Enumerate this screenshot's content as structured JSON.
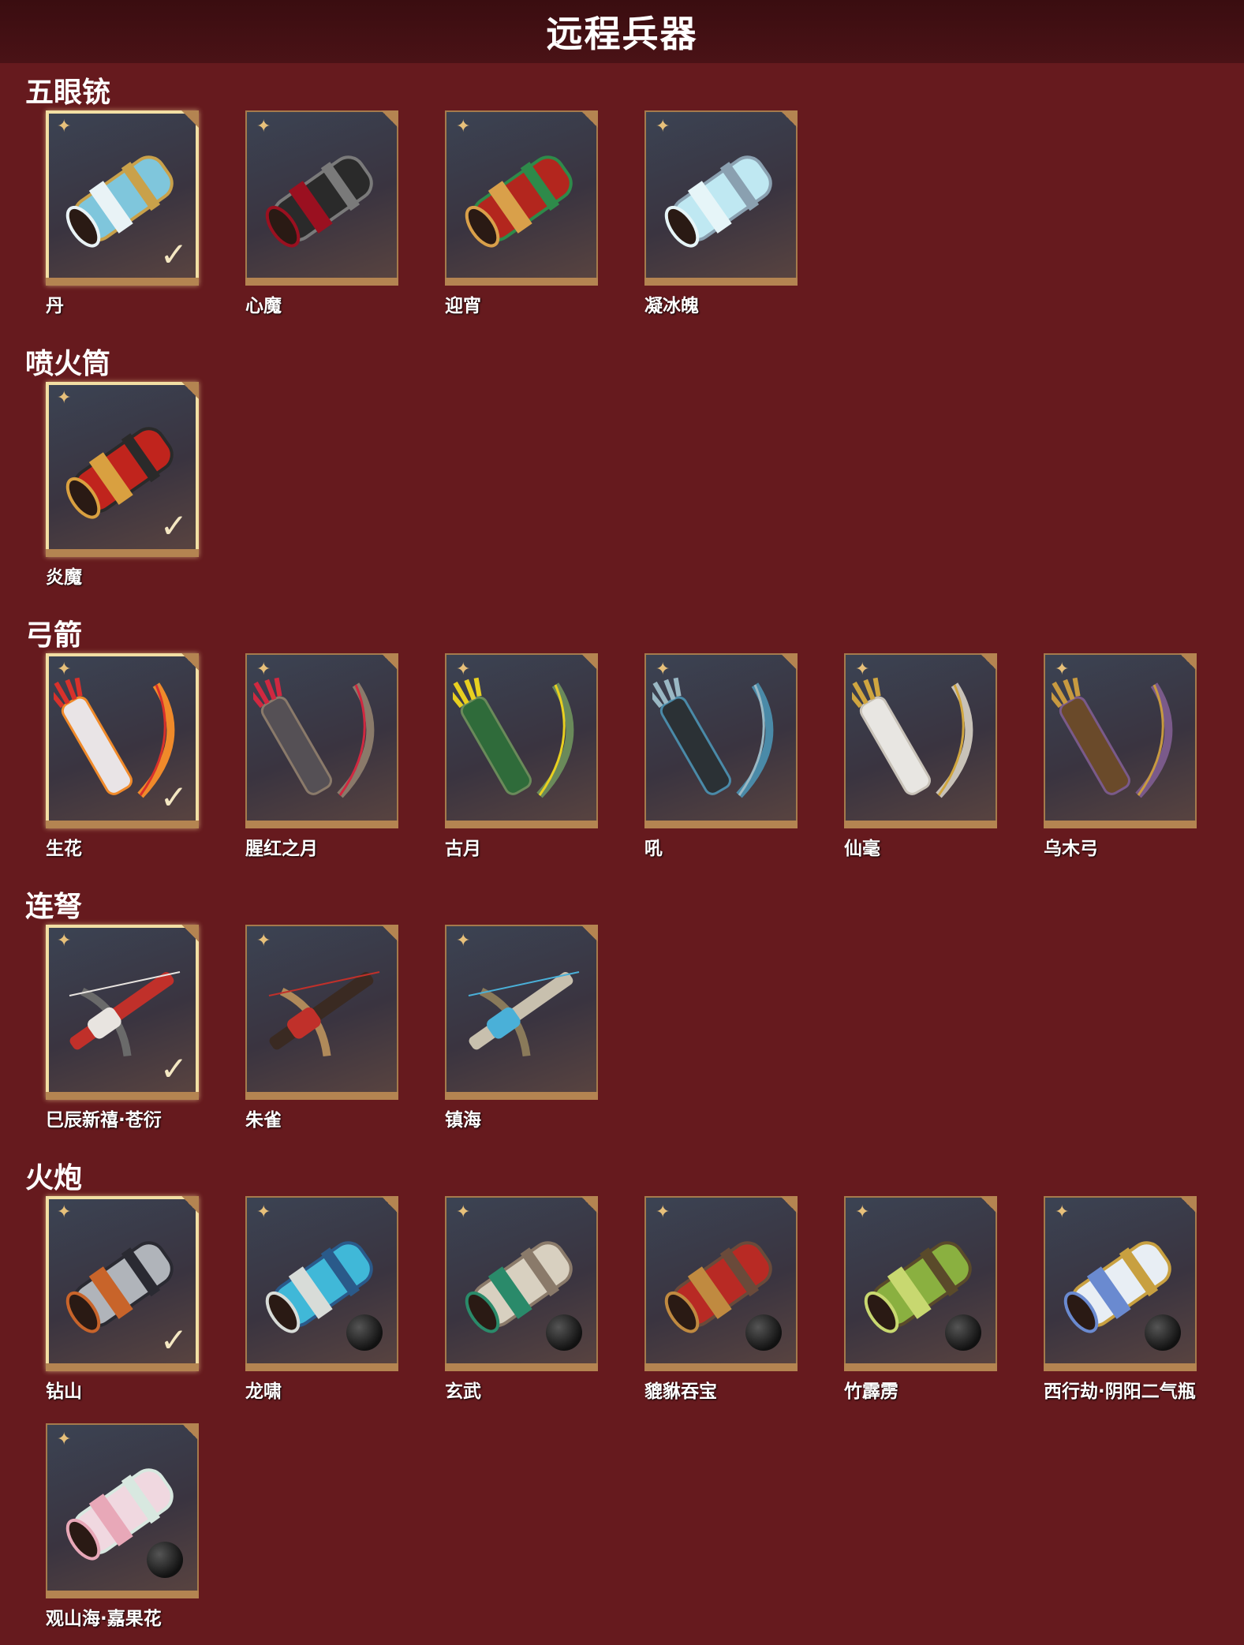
{
  "page_title": "远程兵器",
  "categories": [
    {
      "name": "五眼铳",
      "items": [
        {
          "label": "丹",
          "selected": true,
          "ammo": false,
          "colors": [
            "#7fc6dc",
            "#e9f3f6",
            "#c9a14a"
          ]
        },
        {
          "label": "心魔",
          "selected": false,
          "ammo": false,
          "colors": [
            "#2a2a2a",
            "#9a1020",
            "#7a7a7a"
          ]
        },
        {
          "label": "迎宵",
          "selected": false,
          "ammo": false,
          "colors": [
            "#b3261e",
            "#d9a04a",
            "#2e8a4a"
          ]
        },
        {
          "label": "凝冰魄",
          "selected": false,
          "ammo": false,
          "colors": [
            "#bfe8f2",
            "#e6f5f8",
            "#8aa0b0"
          ]
        }
      ]
    },
    {
      "name": "喷火筒",
      "items": [
        {
          "label": "炎魔",
          "selected": true,
          "ammo": false,
          "colors": [
            "#c0241d",
            "#d9a040",
            "#2a2a2a"
          ]
        }
      ]
    },
    {
      "name": "弓箭",
      "items": [
        {
          "label": "生花",
          "selected": true,
          "ammo": false,
          "colors": [
            "#e9e4e6",
            "#d8312b",
            "#f08a2a"
          ]
        },
        {
          "label": "腥红之月",
          "selected": false,
          "ammo": false,
          "colors": [
            "#555055",
            "#d02840",
            "#8a7a6a"
          ]
        },
        {
          "label": "古月",
          "selected": false,
          "ammo": false,
          "colors": [
            "#2f6b3a",
            "#e8d020",
            "#6a8a5a"
          ]
        },
        {
          "label": "吼",
          "selected": false,
          "ammo": false,
          "colors": [
            "#2b3135",
            "#9ab8c4",
            "#4a8aa8"
          ]
        },
        {
          "label": "仙毫",
          "selected": false,
          "ammo": false,
          "colors": [
            "#e8e6e2",
            "#d0a640",
            "#c8c2b8"
          ]
        },
        {
          "label": "乌木弓",
          "selected": false,
          "ammo": false,
          "colors": [
            "#6a4a2a",
            "#c89a40",
            "#7a5a8a"
          ]
        }
      ]
    },
    {
      "name": "连弩",
      "items": [
        {
          "label": "巳辰新禧·苍衍",
          "selected": true,
          "ammo": false,
          "colors": [
            "#c0302a",
            "#e8e4e0",
            "#6a6a6a"
          ]
        },
        {
          "label": "朱雀",
          "selected": false,
          "ammo": false,
          "colors": [
            "#3a2a22",
            "#c0302a",
            "#b08a5a"
          ]
        },
        {
          "label": "镇海",
          "selected": false,
          "ammo": false,
          "colors": [
            "#c8c0ae",
            "#4ab0d8",
            "#8a7a5a"
          ]
        }
      ]
    },
    {
      "name": "火炮",
      "items": [
        {
          "label": "钻山",
          "selected": true,
          "ammo": false,
          "colors": [
            "#b0b4ba",
            "#c8642a",
            "#2a2a32"
          ]
        },
        {
          "label": "龙啸",
          "selected": false,
          "ammo": true,
          "colors": [
            "#40b8d8",
            "#d8dcd8",
            "#2a5a8a"
          ]
        },
        {
          "label": "玄武",
          "selected": false,
          "ammo": true,
          "colors": [
            "#d8d0c0",
            "#2a8a6a",
            "#8a7a6a"
          ]
        },
        {
          "label": "貔貅吞宝",
          "selected": false,
          "ammo": true,
          "colors": [
            "#b82a24",
            "#c08a40",
            "#6a4a3a"
          ]
        },
        {
          "label": "竹霹雳",
          "selected": false,
          "ammo": true,
          "colors": [
            "#8ab040",
            "#c8d870",
            "#5a4a2a"
          ]
        },
        {
          "label": "西行劫·阴阳二气瓶",
          "selected": false,
          "ammo": true,
          "colors": [
            "#e8eef4",
            "#6a8ad0",
            "#c8a040"
          ]
        },
        {
          "label": "观山海·嘉果花",
          "selected": false,
          "ammo": true,
          "colors": [
            "#f0d8e0",
            "#e8a8b8",
            "#d8e8e0"
          ]
        }
      ]
    }
  ]
}
